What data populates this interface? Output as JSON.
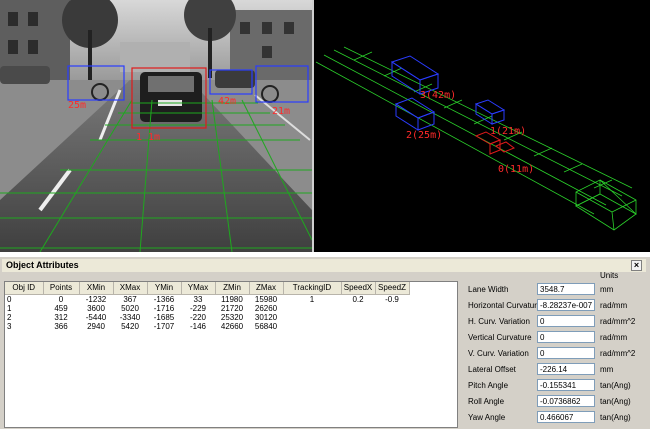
{
  "camera": {
    "detections": [
      {
        "label": "25m"
      },
      {
        "label": "1 1m"
      },
      {
        "label": "42m"
      },
      {
        "label": "21m"
      }
    ]
  },
  "scene": {
    "labels": [
      "3(42m)",
      "2(25m)",
      "1(21m)",
      "0(11m)"
    ]
  },
  "window": {
    "title": "Object Attributes",
    "close_glyph": "×"
  },
  "table": {
    "columns": [
      "Obj ID",
      "Points",
      "XMin",
      "XMax",
      "YMin",
      "YMax",
      "ZMin",
      "ZMax",
      "TrackingID",
      "SpeedX",
      "SpeedZ"
    ],
    "rows": [
      [
        "0",
        "0",
        "-1232",
        "367",
        "-1366",
        "33",
        "11980",
        "15980",
        "1",
        "0.2",
        "-0.9"
      ],
      [
        "1",
        "459",
        "3600",
        "5020",
        "-1716",
        "-229",
        "21720",
        "26260",
        "",
        "",
        ""
      ],
      [
        "2",
        "312",
        "-5440",
        "-3340",
        "-1685",
        "-220",
        "25320",
        "30120",
        "",
        "",
        ""
      ],
      [
        "3",
        "366",
        "2940",
        "5420",
        "-1707",
        "-146",
        "42660",
        "56840",
        "",
        "",
        ""
      ]
    ]
  },
  "attributes": {
    "units_header": "Units",
    "items": [
      {
        "label": "Lane Width",
        "value": "3548.7",
        "unit": "mm"
      },
      {
        "label": "Horizontal Curvature",
        "value": "-8.28237e-007",
        "unit": "rad/mm"
      },
      {
        "label": "H. Curv. Variation",
        "value": "0",
        "unit": "rad/mm^2"
      },
      {
        "label": "Vertical Curvature",
        "value": "0",
        "unit": "rad/mm"
      },
      {
        "label": "V. Curv. Variation",
        "value": "0",
        "unit": "rad/mm^2"
      },
      {
        "label": "Lateral Offset",
        "value": "-226.14",
        "unit": "mm"
      },
      {
        "label": "Pitch Angle",
        "value": "-0.155341",
        "unit": "tan(Ang)"
      },
      {
        "label": "Roll Angle",
        "value": "-0.0736862",
        "unit": "tan(Ang)"
      },
      {
        "label": "Yaw Angle",
        "value": "0.466067",
        "unit": "tan(Ang)"
      }
    ]
  }
}
